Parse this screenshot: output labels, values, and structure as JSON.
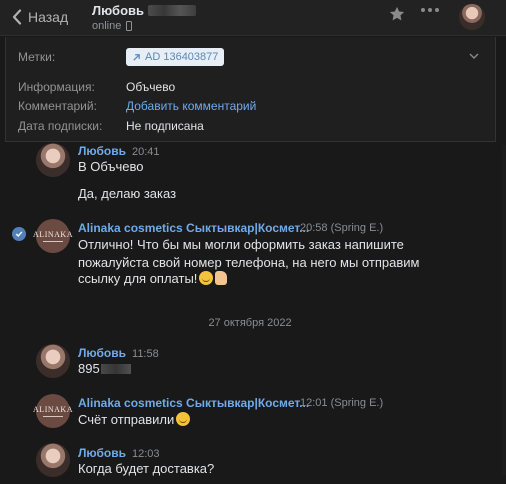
{
  "header": {
    "back_label": "Назад",
    "contact_name": "Любовь",
    "status": "online"
  },
  "info": {
    "tags_label": "Метки:",
    "tag_value": "AD 136403877",
    "info_label": "Информация:",
    "info_value": "Объчево",
    "comment_label": "Комментарий:",
    "comment_link": "Добавить комментарий",
    "subscription_label": "Дата подписки:",
    "subscription_value": "Не подписана"
  },
  "date_separator": "27 октября 2022",
  "messages": [
    {
      "author": "Любовь",
      "time": "20:41",
      "lines": [
        "В Объчево",
        "",
        "Да, делаю заказ"
      ]
    },
    {
      "author": "Alinaka cosmetics Сыктывкар|Космет...",
      "time": "20:58 (Spring E.)",
      "avatar_text": "ALINAKA",
      "lines": [
        "Отлично! Что бы мы могли оформить заказ напишите",
        "пожалуйста свой номер телефона, на него мы отправим",
        "ссылку для оплаты!"
      ]
    },
    {
      "author": "Любовь",
      "time": "11:58",
      "lines": [
        "895"
      ]
    },
    {
      "author": "Alinaka cosmetics Сыктывкар|Космет...",
      "time": "12:01 (Spring E.)",
      "avatar_text": "ALINAKA",
      "lines": [
        "Счёт отправили"
      ]
    },
    {
      "author": "Любовь",
      "time": "12:03",
      "lines": [
        "Когда будет доставка?"
      ]
    }
  ],
  "colors": {
    "background": "#191919",
    "link": "#71aaeb",
    "text": "#e1e3e6",
    "muted": "#8a8d91"
  }
}
